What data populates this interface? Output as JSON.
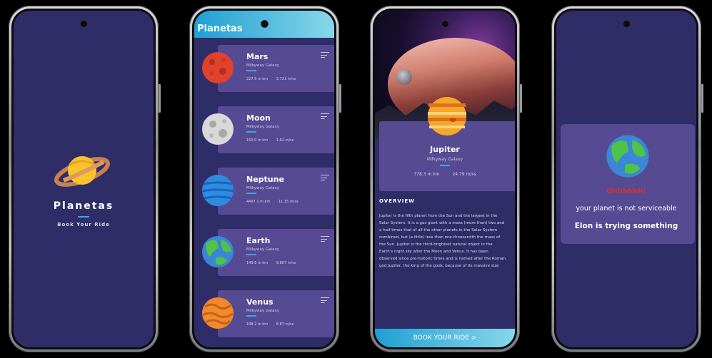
{
  "splash": {
    "title": "Planetas",
    "subtitle": "Book Your Ride"
  },
  "list": {
    "header": "Planetas",
    "planets": [
      {
        "name": "Mars",
        "galaxy": "Milkyway Galaxy",
        "distance": "227.9 m km",
        "gravity": "3.721 m/ss"
      },
      {
        "name": "Moon",
        "galaxy": "Milkyway Galaxy",
        "distance": "150.0 m km",
        "gravity": "1.62 m/ss"
      },
      {
        "name": "Neptune",
        "galaxy": "Milkyway Galaxy",
        "distance": "4497.1 m km",
        "gravity": "11.15 m/ss"
      },
      {
        "name": "Earth",
        "galaxy": "Milkyway Galaxy",
        "distance": "149.6 m km",
        "gravity": "9.807 m/ss"
      },
      {
        "name": "Venus",
        "galaxy": "Milkyway Galaxy",
        "distance": "108.2 m km",
        "gravity": "8.87 m/ss"
      }
    ]
  },
  "detail": {
    "name": "Jupiter",
    "galaxy": "Milkyway Galaxy",
    "distance": "778.3 m km",
    "gravity": "24.79 m/ss",
    "overview_title": "OVERVIEW",
    "overview_text": "Jupiter is the fifth planet from the Sun and the largest in the Solar System. It is a gas giant with a mass (more than) two and a half times that of all the other planets in the Solar System combined, but (a little) less than one-thousandth the mass of the Sun. Jupiter is the third-brightest natural object in the Earth's night sky after the Moon and Venus. It has been observed since pre-historic times and is named after the Roman god Jupiter, the king of the gods, because of its massive size",
    "book_button": "BOOK YOUR RIDE >"
  },
  "error": {
    "headline": "Ohhhhhh!",
    "message": "your planet is not serviceable",
    "submessage": "Elon is trying something"
  },
  "colors": {
    "accent": "#3aa6e6",
    "card": "#564a93",
    "background": "#2f2d68",
    "error": "#e0302a"
  }
}
